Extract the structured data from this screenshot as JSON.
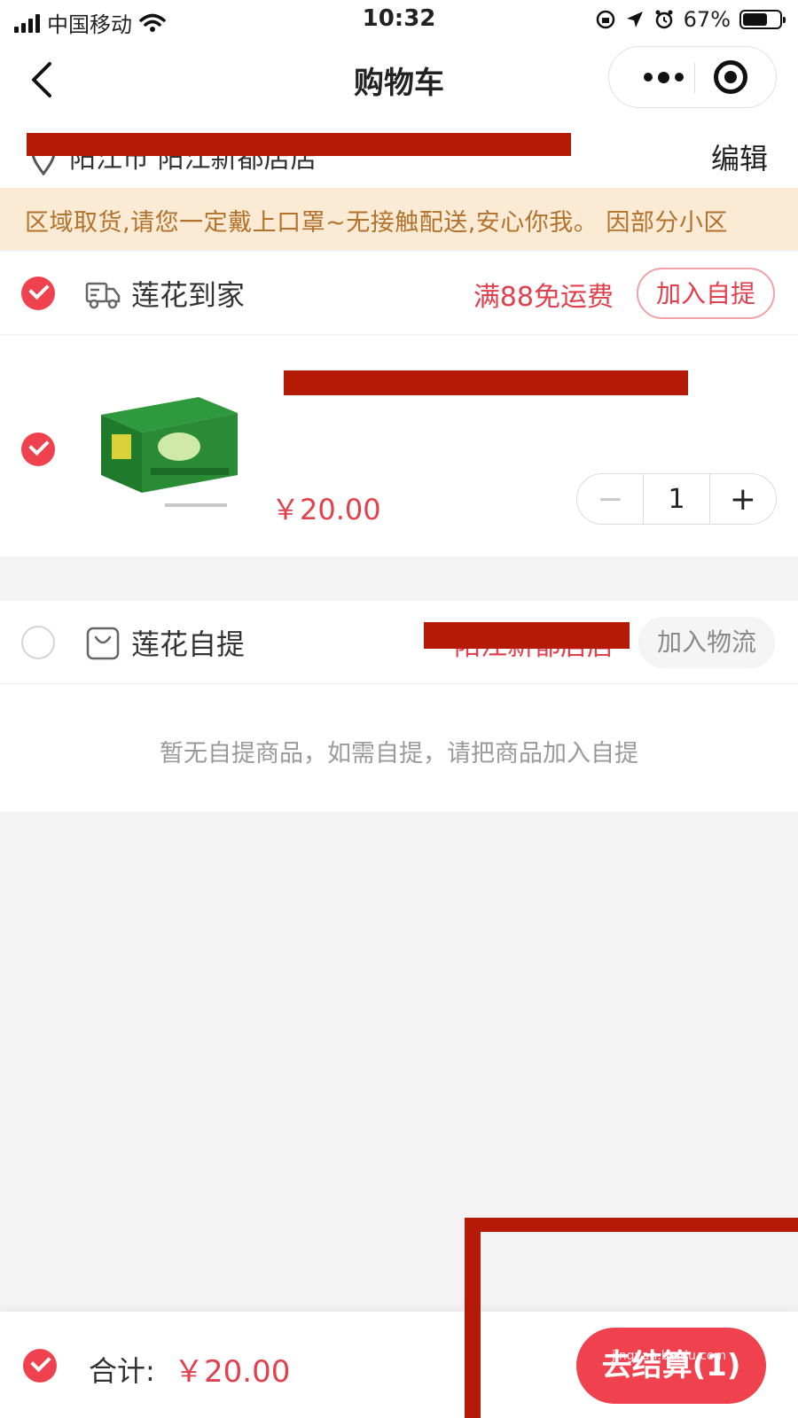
{
  "status_bar": {
    "carrier": "中国移动",
    "time": "10:32",
    "battery": "67%"
  },
  "nav": {
    "title": "购物车"
  },
  "address": {
    "store_name": "阳江市 阳江新都店店",
    "edit_label": "编辑"
  },
  "notice": {
    "text": "区域取货,请您一定戴上口罩~无接触配送,安心你我。     因部分小区"
  },
  "delivery_section": {
    "title": "莲花到家",
    "free_shipping": "满88免运费",
    "action_label": "加入自提",
    "item": {
      "price": "￥20.00",
      "quantity": "1",
      "minus": "−",
      "plus": "+"
    }
  },
  "pickup_section": {
    "title": "莲花自提",
    "store_name": "阳江新都店店",
    "action_label": "加入物流",
    "empty_message": "暂无自提商品，如需自提，请把商品加入自提"
  },
  "footer": {
    "total_label": "合计:",
    "total_value": "￥20.00",
    "checkout_label": "去结算(1)",
    "watermark": "jingyan.baidu.com"
  },
  "colors": {
    "accent": "#f0424e",
    "price": "#e2404c",
    "notice_text": "#b3722c",
    "notice_bg": "#fcebd4",
    "redaction": "#b41a05"
  }
}
